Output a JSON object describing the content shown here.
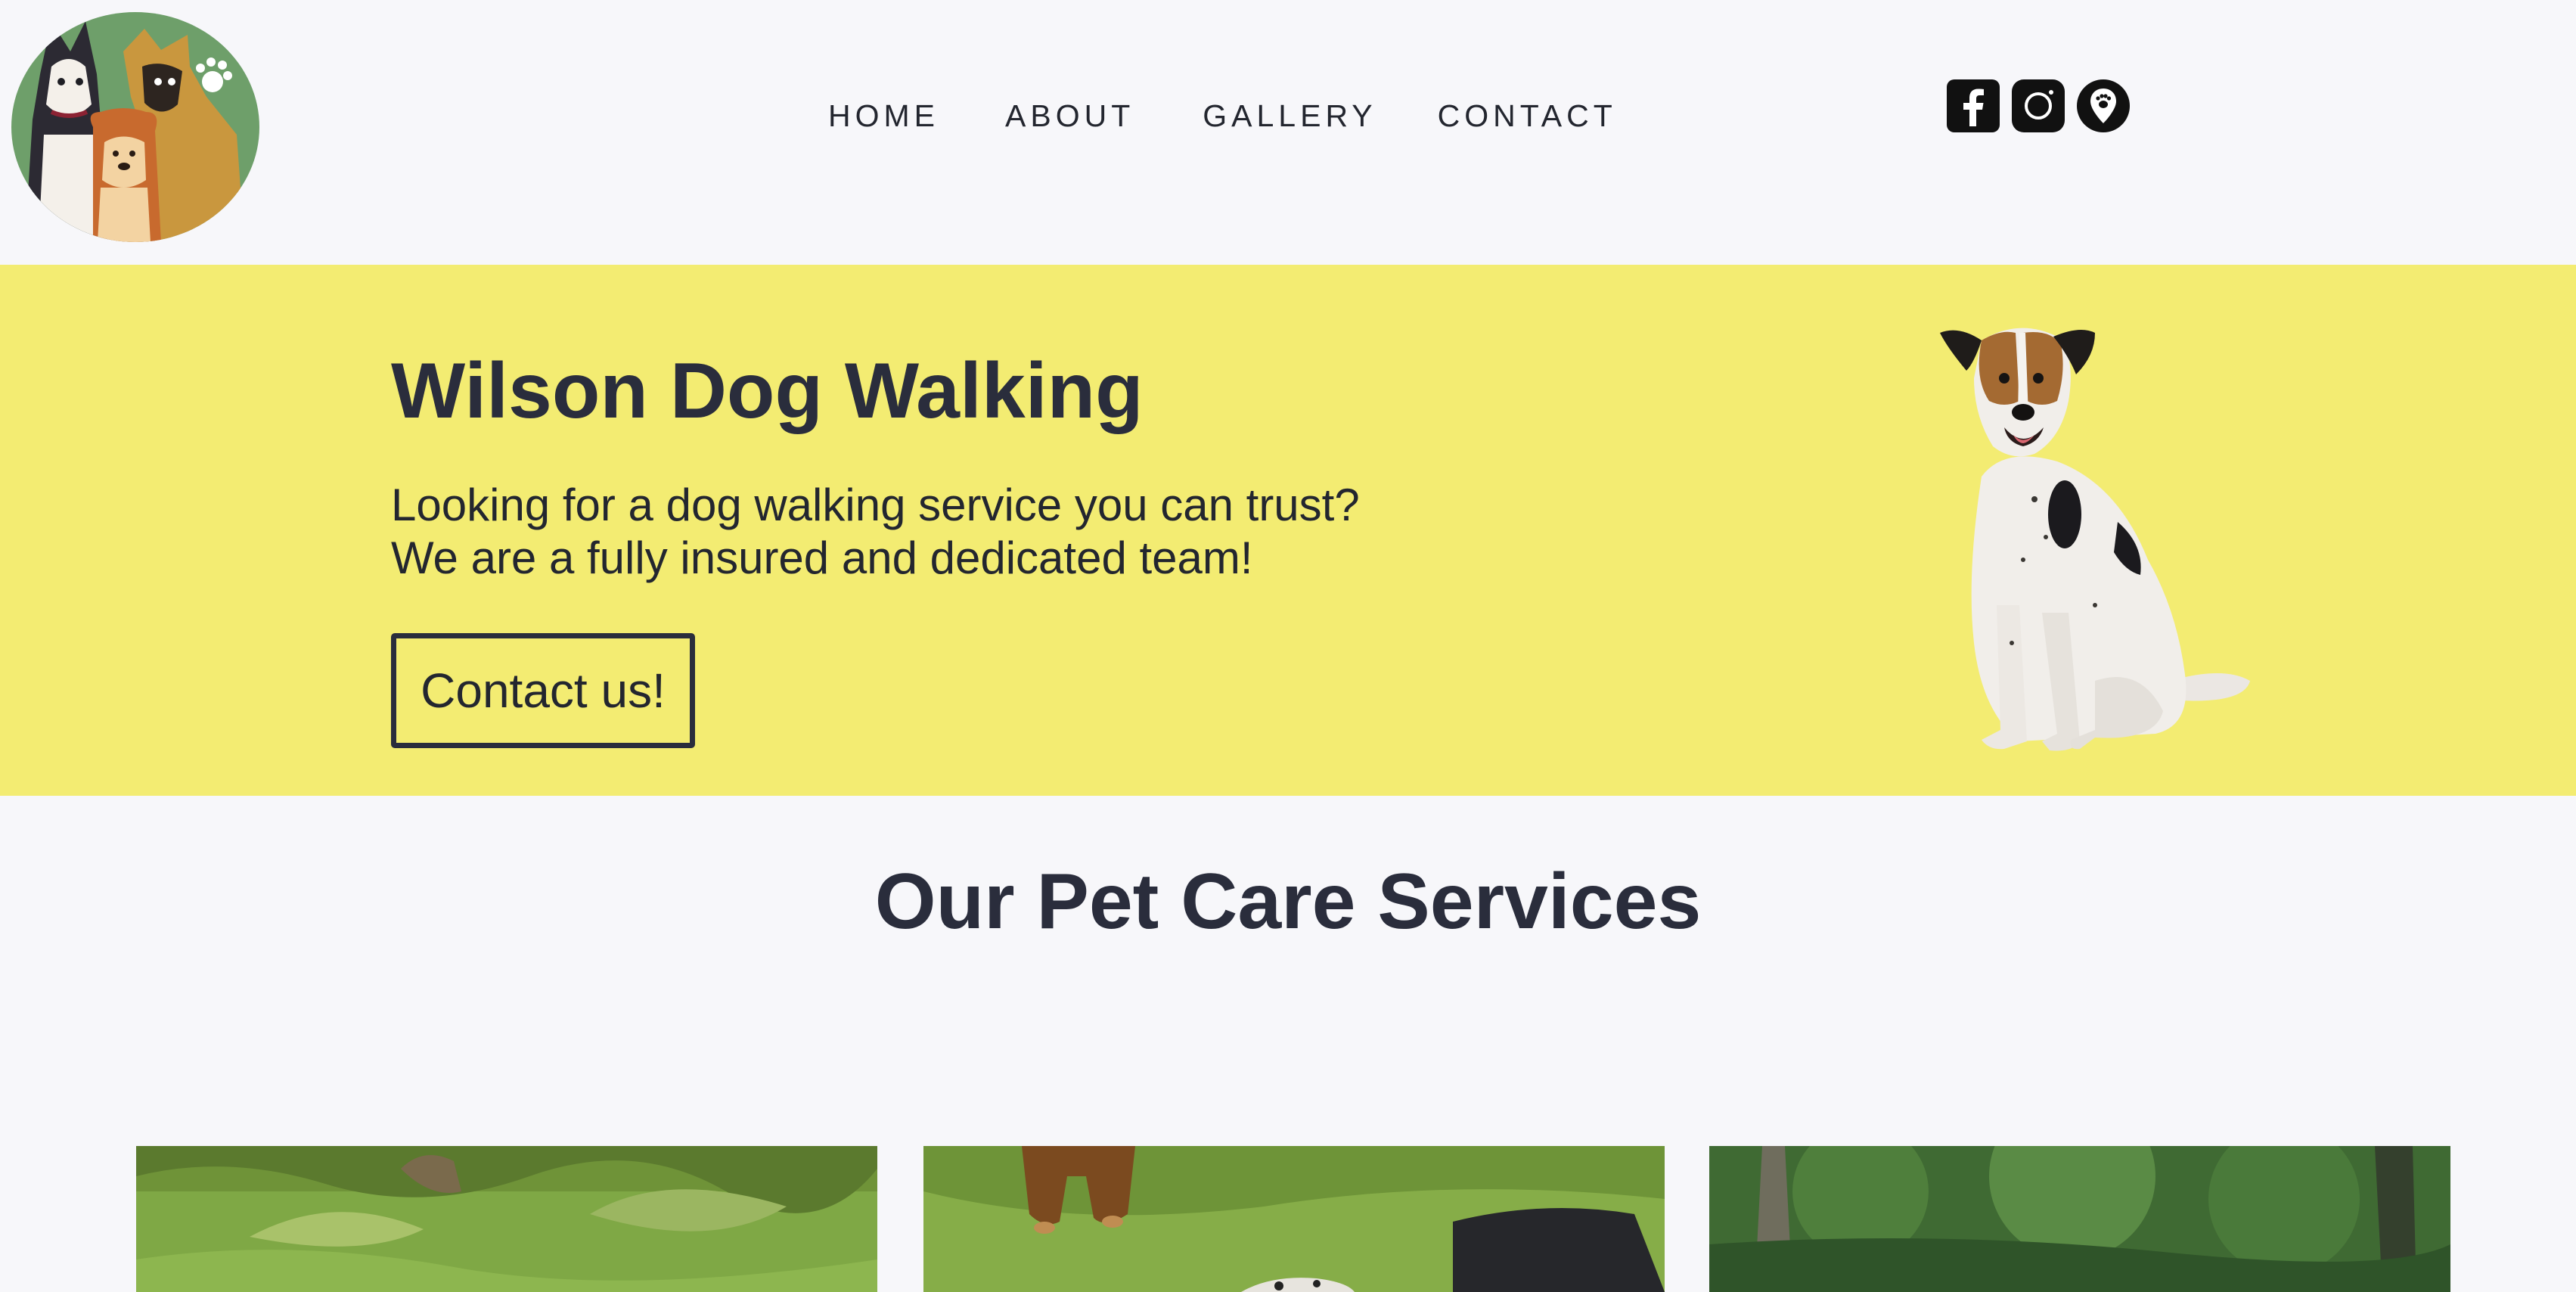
{
  "header": {
    "logo_alt": "Wilson Dog Walking logo",
    "nav": [
      {
        "label": "HOME"
      },
      {
        "label": "ABOUT"
      },
      {
        "label": "GALLERY"
      },
      {
        "label": "CONTACT"
      }
    ],
    "social": [
      {
        "icon": "facebook-icon"
      },
      {
        "icon": "instagram-icon"
      },
      {
        "icon": "location-pin-icon"
      }
    ]
  },
  "hero": {
    "title": "Wilson Dog Walking",
    "line1": "Looking for a dog walking service you can trust?",
    "line2": "We are a fully insured and dedicated team!",
    "cta_label": "Contact us!",
    "background": "#f3ec72"
  },
  "services": {
    "title": "Our Pet Care Services"
  },
  "colors": {
    "page_bg": "#f7f7fa",
    "text": "#2a2d3c",
    "accent": "#f3ec72"
  }
}
